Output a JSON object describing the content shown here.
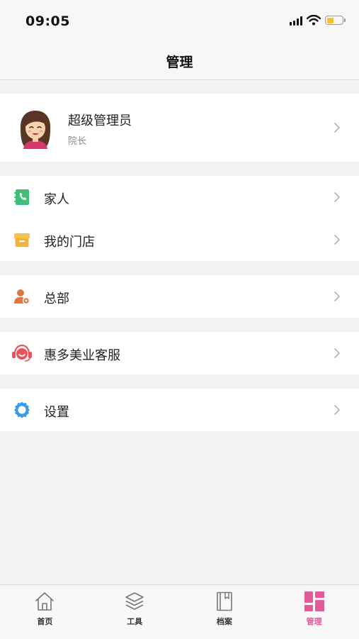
{
  "status_bar": {
    "time": "09:05",
    "battery_level": 0.45,
    "battery_color": "#f1c232"
  },
  "header": {
    "title": "管理"
  },
  "profile": {
    "name": "超级管理员",
    "role": "院长",
    "avatar_icon": "female-avatar"
  },
  "menu_groups": [
    {
      "items": [
        {
          "label": "家人",
          "icon": "phone-contact-book-icon",
          "color": "#3fbf7a"
        },
        {
          "label": "我的门店",
          "icon": "store-box-icon",
          "color": "#f3b23c"
        }
      ]
    },
    {
      "items": [
        {
          "label": "总部",
          "icon": "user-settings-icon",
          "color": "#e0763f"
        }
      ]
    },
    {
      "items": [
        {
          "label": "惠多美业客服",
          "icon": "customer-service-headset-icon",
          "color": "#e8545a"
        }
      ]
    },
    {
      "items": [
        {
          "label": "设置",
          "icon": "gear-icon",
          "color": "#3b9be4"
        }
      ]
    }
  ],
  "tab_bar": {
    "active_color": "#e6589a",
    "tabs": [
      {
        "label": "首页",
        "icon": "home-icon",
        "active": false
      },
      {
        "label": "工具",
        "icon": "layers-icon",
        "active": false
      },
      {
        "label": "档案",
        "icon": "book-icon",
        "active": false
      },
      {
        "label": "管理",
        "icon": "dashboard-grid-icon",
        "active": true
      }
    ]
  }
}
